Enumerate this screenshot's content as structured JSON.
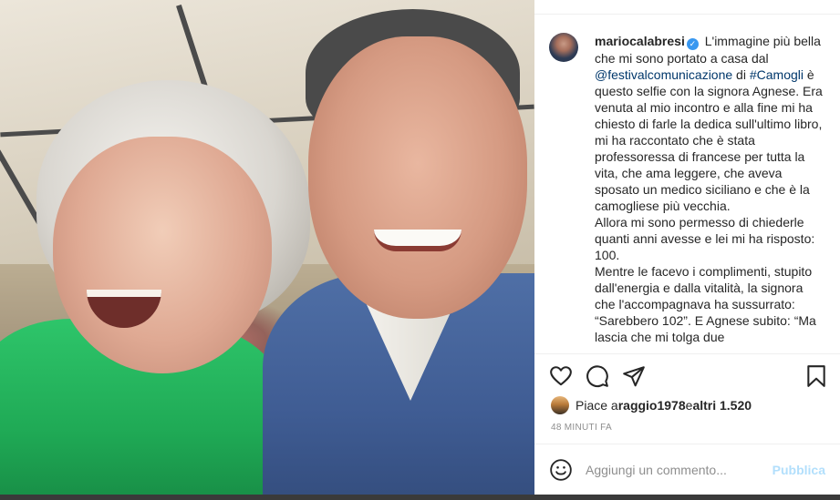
{
  "post": {
    "username": "mariocalabresi",
    "verified_badge": "✓",
    "caption": {
      "intro": " L'immagine più bella che mi sono portato a casa dal ",
      "mention": "@festivalcomunicazione",
      "mid": " di ",
      "hashtag": "#Camogli",
      "after": " è questo selfie con la signora Agnese. Era venuta al mio incontro e alla fine mi ha chiesto di farle la dedica sull'ultimo libro, mi ha raccontato che è stata professoressa di francese per tutta la vita, che ama leggere, che aveva sposato un medico siciliano e che è la camogliese più vecchia.",
      "p2": "Allora mi sono permesso di chiederle quanti anni avesse e lei mi ha risposto: 100.",
      "p3": "Mentre le facevo i complimenti, stupito dall'energia e dalla vitalità, la signora che l'accompagnava ha sussurrato: “Sarebbero 102”. E Agnese subito: “Ma lascia che mi tolga due"
    }
  },
  "likes": {
    "prefix": "Piace a ",
    "user": "raggio1978",
    "mid": " e ",
    "others": "altri 1.520"
  },
  "time_ago": "48 MINUTI FA",
  "comment_box": {
    "placeholder": "Aggiungi un commento...",
    "publish_label": "Pubblica"
  },
  "icons": {
    "like": "heart-icon",
    "comment": "comment-icon",
    "share": "share-icon",
    "save": "bookmark-icon",
    "emoji": "emoji-icon"
  },
  "colors": {
    "link": "#00376b",
    "verified": "#3897f0",
    "publish_disabled": "#b2dffc",
    "muted": "#8e8e8e"
  }
}
